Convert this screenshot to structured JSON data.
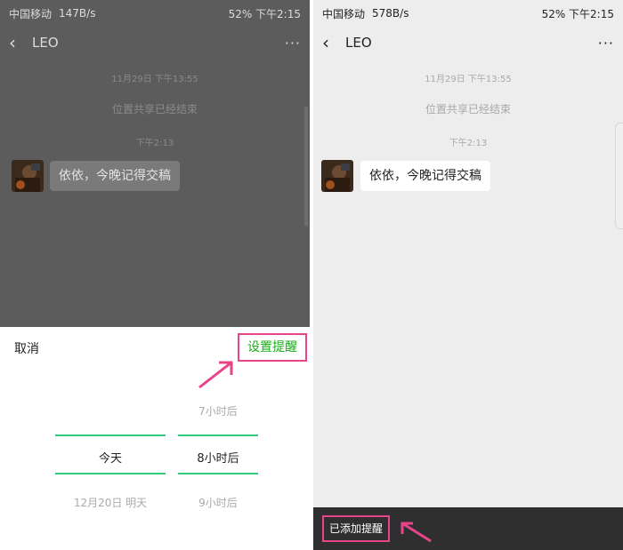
{
  "left": {
    "status": {
      "carrier": "中国移动",
      "speed": "147B/s",
      "icons": "52% 下午2:15"
    },
    "nav": {
      "back": "‹",
      "title": "LEO",
      "more": "···"
    },
    "chat": {
      "timestamp": "11月29日 下午13:55",
      "system": "位置共享已经结束",
      "time2": "下午2:13",
      "message": "依依，今晚记得交稿"
    },
    "picker": {
      "cancel": "取消",
      "confirm": "设置提醒",
      "day_options": [
        "",
        "今天",
        "12月20日 明天"
      ],
      "hour_options": [
        "7小时后",
        "8小时后",
        "9小时后"
      ]
    }
  },
  "right": {
    "status": {
      "carrier": "中国移动",
      "speed": "578B/s",
      "icons": "52% 下午2:15"
    },
    "nav": {
      "back": "‹",
      "title": "LEO",
      "more": "···"
    },
    "chat": {
      "timestamp": "11月29日 下午13:55",
      "system": "位置共享已经结束",
      "time2": "下午2:13",
      "message": "依依，今晚记得交稿"
    },
    "toast": "已添加提醒"
  },
  "colors": {
    "accent_green": "#1aad19",
    "highlight_pink": "#e8448a",
    "picker_line": "#2fca7a"
  }
}
